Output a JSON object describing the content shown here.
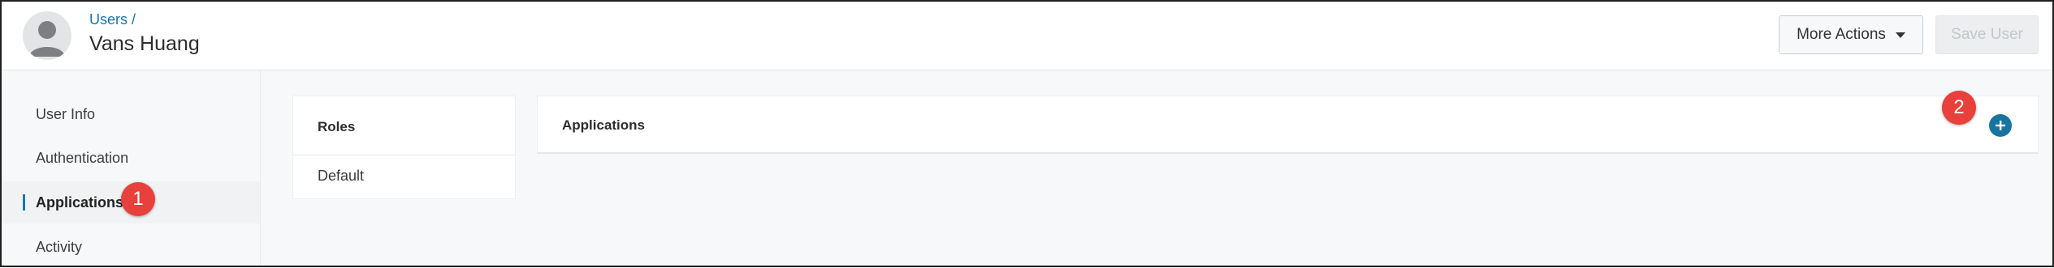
{
  "header": {
    "breadcrumb": "Users /",
    "title": "Vans Huang",
    "more_actions_label": "More Actions",
    "save_label": "Save User",
    "avatar_icon": "user-avatar-icon",
    "caret_icon": "caret-down-icon"
  },
  "sidebar": {
    "items": [
      {
        "label": "User Info"
      },
      {
        "label": "Authentication"
      },
      {
        "label": "Applications",
        "active": true
      },
      {
        "label": "Activity"
      }
    ],
    "active_color": "#1a78b4"
  },
  "roles": {
    "title": "Roles",
    "value": "Default"
  },
  "applications": {
    "title": "Applications",
    "add_icon": "plus-circle-icon",
    "accent": "#17749f"
  },
  "callouts": {
    "first": "1",
    "second": "2",
    "color": "#e8403b"
  }
}
